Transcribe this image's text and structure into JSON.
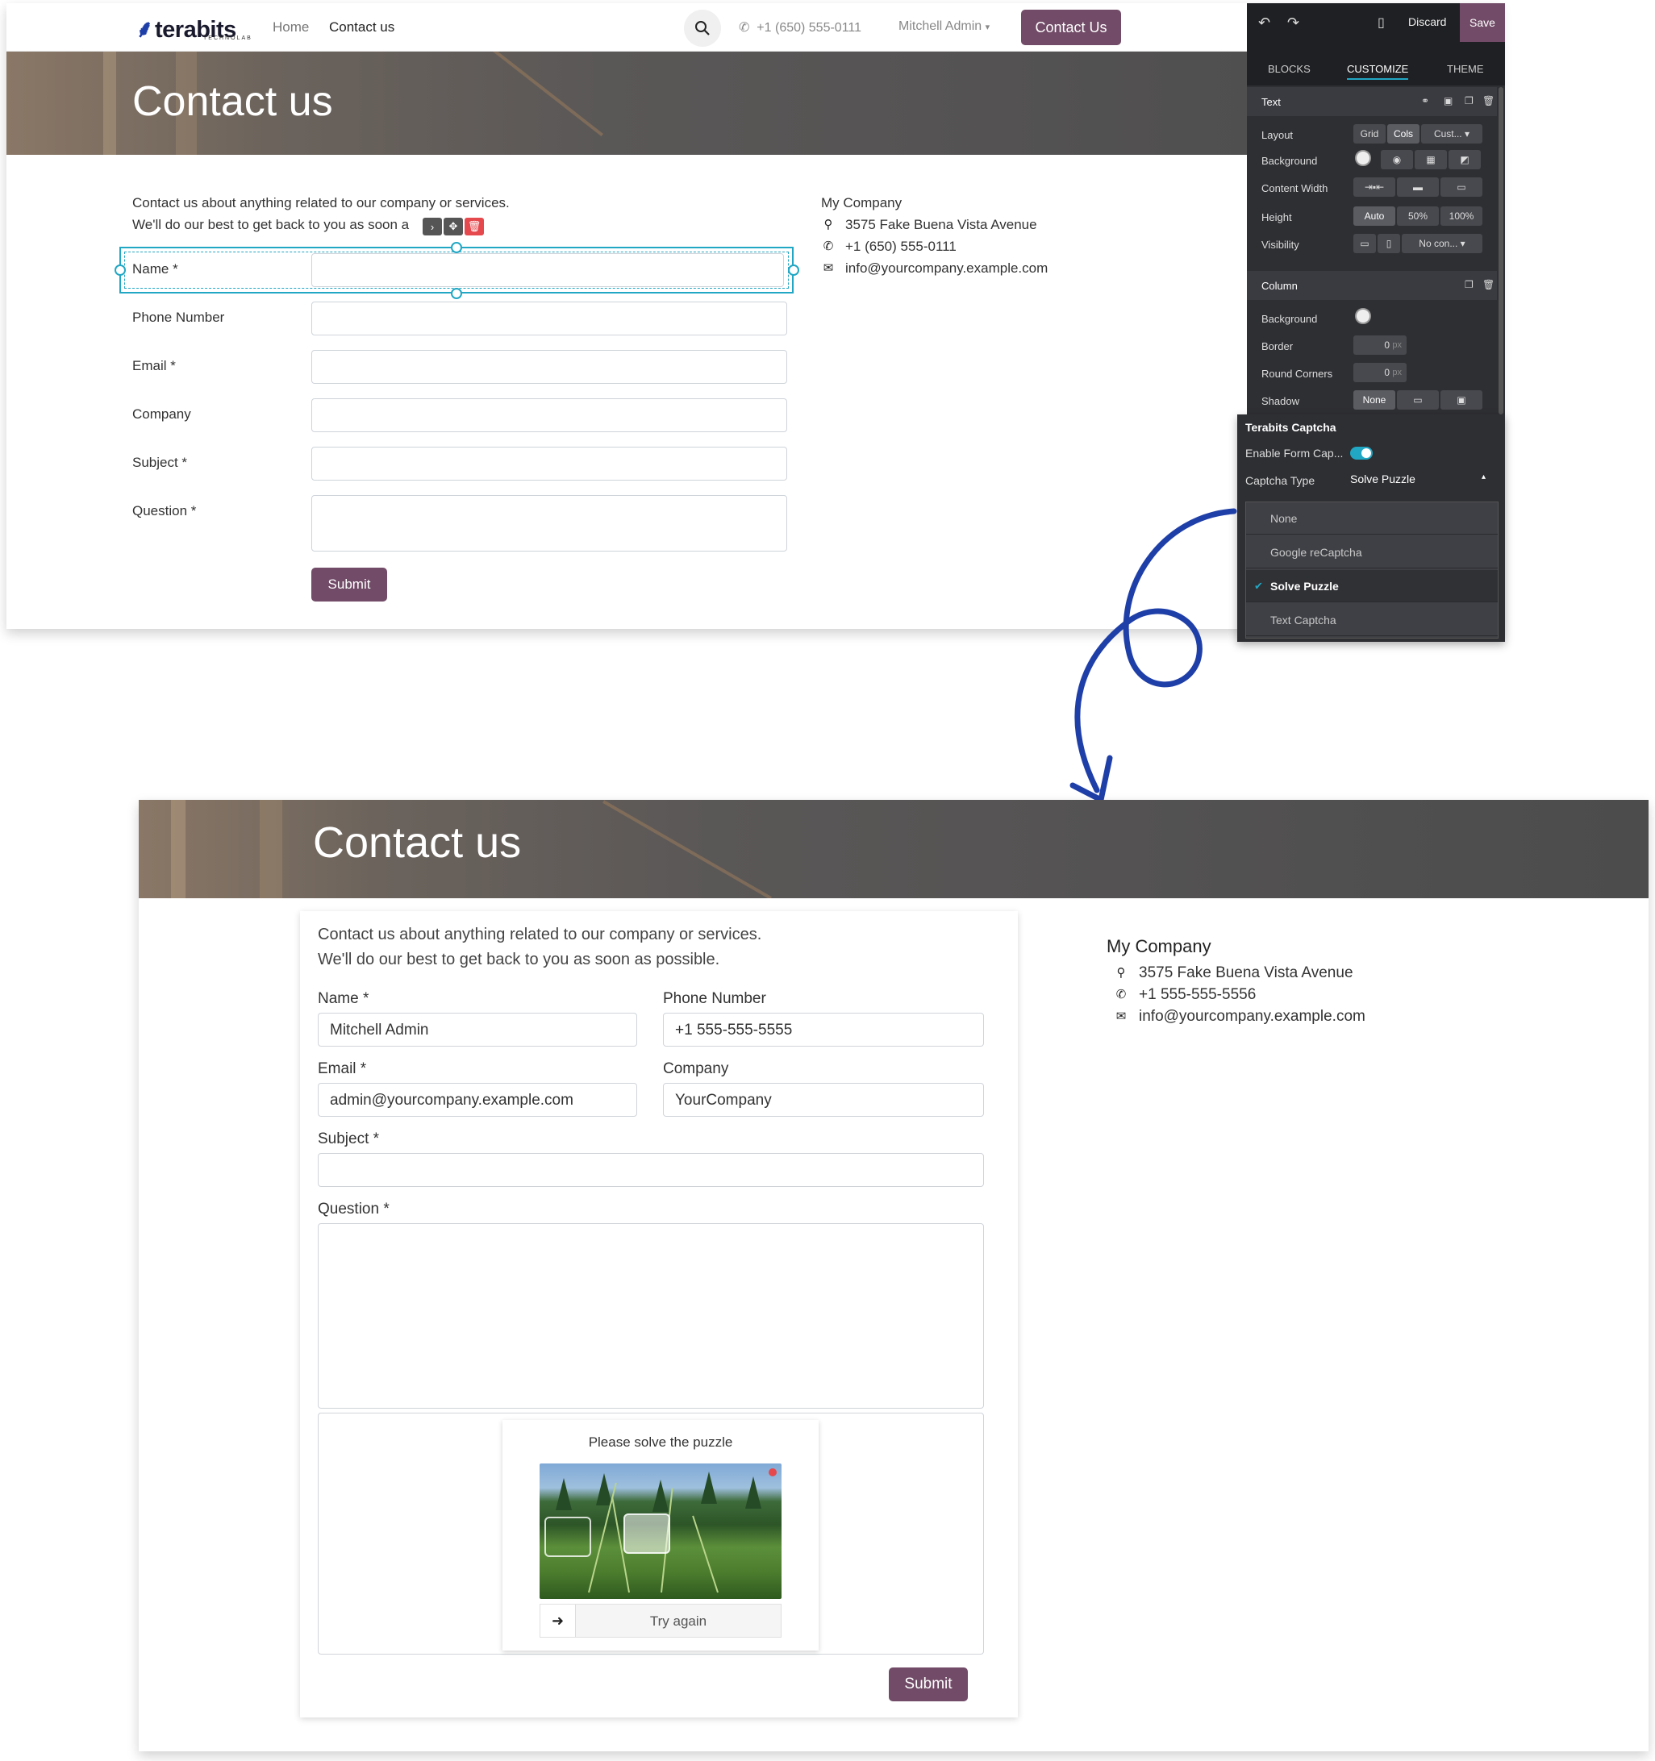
{
  "top": {
    "logo": {
      "brand": "terabits",
      "tagline": "TECHNOLAB"
    },
    "nav": {
      "home": "Home",
      "contact": "Contact us",
      "phone": "+1 (650) 555-0111",
      "user": "Mitchell Admin",
      "cta": "Contact Us"
    },
    "hero_title": "Contact us",
    "intro_line1": "Contact us about anything related to our company or services.",
    "intro_line2": "We'll do our best to get back to you as soon a",
    "fields": {
      "name": "Name *",
      "phone": "Phone Number",
      "email": "Email *",
      "company": "Company",
      "subject": "Subject *",
      "question": "Question *"
    },
    "submit": "Submit",
    "company": {
      "name": "My Company",
      "address": "3575 Fake Buena Vista Avenue",
      "phone": "+1 (650) 555-0111",
      "email": "info@yourcompany.example.com"
    }
  },
  "editor": {
    "discard": "Discard",
    "save": "Save",
    "tabs": {
      "blocks": "BLOCKS",
      "customize": "CUSTOMIZE",
      "theme": "THEME"
    },
    "text_section": "Text",
    "layout": {
      "label": "Layout",
      "grid": "Grid",
      "cols": "Cols",
      "custom": "Cust..."
    },
    "background": "Background",
    "content_width": "Content Width",
    "height": {
      "label": "Height",
      "auto": "Auto",
      "half": "50%",
      "full": "100%"
    },
    "visibility": {
      "label": "Visibility",
      "value": "No con..."
    },
    "column_section": "Column",
    "col_background": "Background",
    "border": {
      "label": "Border",
      "value": "0",
      "unit": "px"
    },
    "round_corners": {
      "label": "Round Corners",
      "value": "0",
      "unit": "px"
    },
    "shadow": {
      "label": "Shadow",
      "value": "None"
    }
  },
  "captcha_panel": {
    "title": "Terabits Captcha",
    "enable_label": "Enable Form Cap...",
    "type_label": "Captcha Type",
    "type_value": "Solve Puzzle",
    "options": [
      "None",
      "Google reCaptcha",
      "Solve Puzzle",
      "Text Captcha"
    ]
  },
  "bottom": {
    "hero_title": "Contact us",
    "intro_line1": "Contact us about anything related to our company or services.",
    "intro_line2": "We'll do our best to get back to you as soon as possible.",
    "labels": {
      "name": "Name *",
      "phone": "Phone Number",
      "email": "Email *",
      "company": "Company",
      "subject": "Subject *",
      "question": "Question *"
    },
    "values": {
      "name": "Mitchell Admin",
      "phone": "+1 555-555-5555",
      "email": "admin@yourcompany.example.com",
      "company": "YourCompany"
    },
    "captcha_title": "Please solve the puzzle",
    "try_again": "Try again",
    "submit": "Submit",
    "company": {
      "name": "My Company",
      "address": "3575 Fake Buena Vista Avenue",
      "phone": "+1 555-555-5556",
      "email": "info@yourcompany.example.com"
    }
  },
  "colors": {
    "brand": "#714b67",
    "accent": "#21a7c4",
    "arrow": "#1f3fa8",
    "panel": "#2e2f33"
  },
  "icons": [
    "search-icon",
    "phone-icon",
    "map-marker-icon",
    "envelope-icon",
    "undo-icon",
    "redo-icon",
    "mobile-icon",
    "trash-icon",
    "copy-icon",
    "check-icon",
    "arrow-right-icon",
    "move-icon",
    "chevron-down-icon"
  ]
}
